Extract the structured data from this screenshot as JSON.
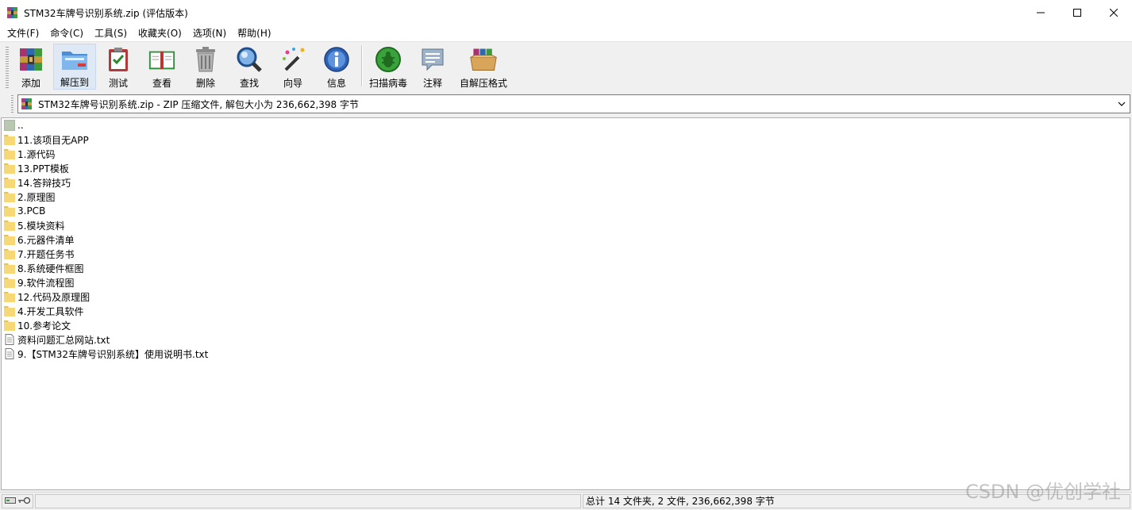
{
  "window": {
    "title": "STM32车牌号识别系统.zip (评估版本)",
    "app_icon": "winrar-icon",
    "controls": [
      "minimize-icon",
      "maximize-icon",
      "close-icon"
    ]
  },
  "menu": [
    {
      "label": "文件(F)"
    },
    {
      "label": "命令(C)"
    },
    {
      "label": "工具(S)"
    },
    {
      "label": "收藏夹(O)"
    },
    {
      "label": "选项(N)"
    },
    {
      "label": "帮助(H)"
    }
  ],
  "toolbar": [
    {
      "label": "添加",
      "icon": "add-archive-icon"
    },
    {
      "label": "解压到",
      "icon": "extract-folder-icon"
    },
    {
      "label": "测试",
      "icon": "test-clipboard-icon"
    },
    {
      "label": "查看",
      "icon": "view-book-icon"
    },
    {
      "label": "删除",
      "icon": "trash-icon"
    },
    {
      "label": "查找",
      "icon": "magnifier-icon"
    },
    {
      "label": "向导",
      "icon": "wizard-wand-icon"
    },
    {
      "label": "信息",
      "icon": "info-icon"
    },
    {
      "label": "扫描病毒",
      "icon": "virus-scan-icon"
    },
    {
      "label": "注释",
      "icon": "comment-icon"
    },
    {
      "label": "自解压格式",
      "icon": "sfx-box-icon"
    }
  ],
  "address": {
    "text": "STM32车牌号识别系统.zip - ZIP 压缩文件, 解包大小为 236,662,398 字节"
  },
  "files": [
    {
      "name": "..",
      "type": "up"
    },
    {
      "name": "11.该项目无APP",
      "type": "folder"
    },
    {
      "name": "1.源代码",
      "type": "folder"
    },
    {
      "name": "13.PPT模板",
      "type": "folder"
    },
    {
      "name": "14.答辩技巧",
      "type": "folder"
    },
    {
      "name": "2.原理图",
      "type": "folder"
    },
    {
      "name": "3.PCB",
      "type": "folder"
    },
    {
      "name": "5.模块资料",
      "type": "folder"
    },
    {
      "name": "6.元器件清单",
      "type": "folder"
    },
    {
      "name": "7.开题任务书",
      "type": "folder"
    },
    {
      "name": "8.系统硬件框图",
      "type": "folder"
    },
    {
      "name": "9.软件流程图",
      "type": "folder"
    },
    {
      "name": "12.代码及原理图",
      "type": "folder"
    },
    {
      "name": "4.开发工具软件",
      "type": "folder"
    },
    {
      "name": "10.参考论文",
      "type": "folder"
    },
    {
      "name": "资料问题汇总网站.txt",
      "type": "file"
    },
    {
      "name": "9.【STM32车牌号识别系统】使用说明书.txt",
      "type": "file"
    }
  ],
  "status": {
    "summary": "总计 14 文件夹, 2 文件, 236,662,398 字节",
    "watermark": "CSDN @优创学社"
  }
}
